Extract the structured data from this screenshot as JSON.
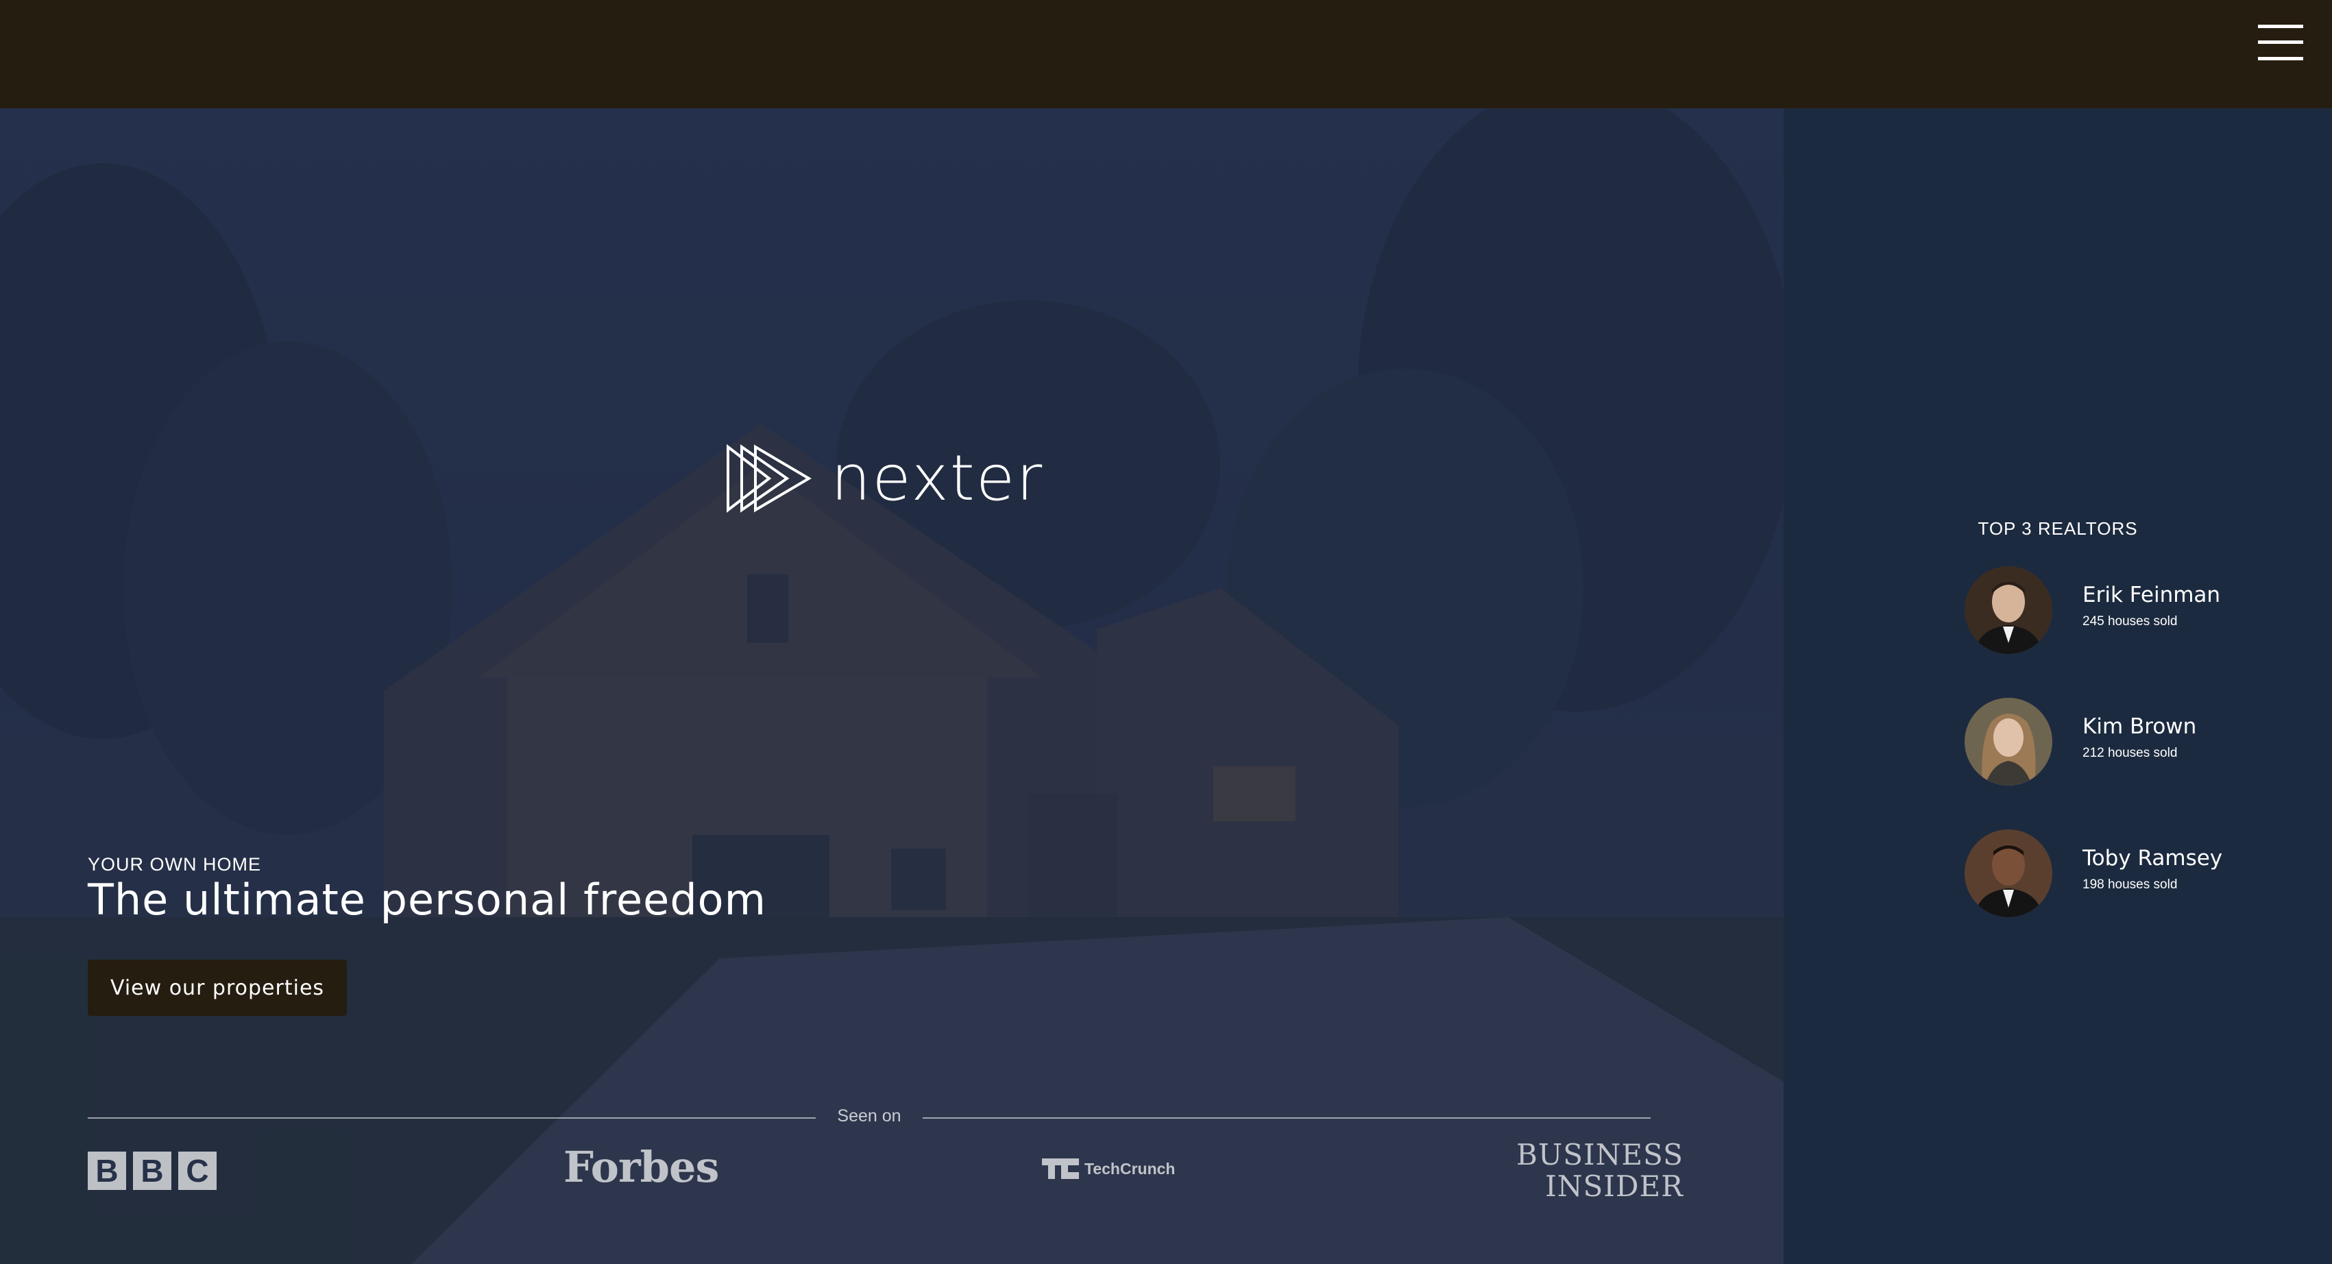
{
  "header": {
    "menu_icon": "hamburger-menu-icon",
    "background": "#261d11"
  },
  "brand": {
    "name": "nexter",
    "logo_icon": "triple-play-triangles-icon"
  },
  "hero": {
    "eyebrow": "YOUR OWN HOME",
    "headline": "The ultimate personal freedom",
    "cta_label": "View our properties",
    "background_image": "house-at-dusk-photo"
  },
  "seen_on": {
    "label": "Seen on",
    "logos": [
      {
        "name": "BBC",
        "letters": [
          "B",
          "B",
          "C"
        ]
      },
      {
        "name": "Forbes"
      },
      {
        "name": "TechCrunch"
      },
      {
        "name": "Business Insider",
        "lines": [
          "BUSINESS",
          "INSIDER"
        ]
      }
    ]
  },
  "sidebar": {
    "title": "TOP 3 REALTORS",
    "realtors": [
      {
        "name": "Erik Feinman",
        "sold": "245 houses sold"
      },
      {
        "name": "Kim Brown",
        "sold": "212 houses sold"
      },
      {
        "name": "Toby Ramsey",
        "sold": "198 houses sold"
      }
    ]
  },
  "colors": {
    "dark_brown": "#261d11",
    "navy": "#1c2a3f",
    "hero_overlay": "#202c48"
  }
}
